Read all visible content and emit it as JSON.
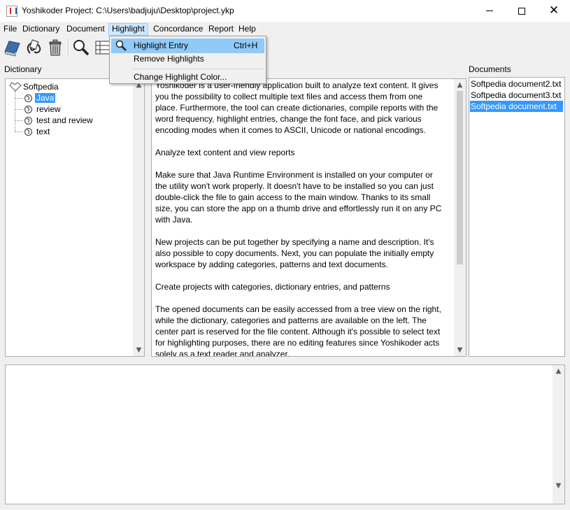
{
  "window": {
    "title": "Yoshikoder Project: C:\\Users\\badjuju\\Desktop\\project.ykp",
    "minimize_glyph": "",
    "maximize_glyph": "",
    "close_glyph": "✕"
  },
  "menubar": {
    "items": [
      "File",
      "Dictionary",
      "Document",
      "Highlight",
      "Concordance",
      "Report",
      "Help"
    ],
    "open_menu": "Highlight"
  },
  "highlight_menu": {
    "items": [
      {
        "label": "Highlight Entry",
        "shortcut": "Ctrl+H",
        "icon": "magnifier-icon",
        "highlighted": true
      },
      {
        "label": "Remove Highlights",
        "shortcut": ""
      },
      {
        "label": "Change Highlight Color...",
        "shortcut": ""
      }
    ]
  },
  "toolbar": {
    "buttons": [
      "open-dictionary-icon",
      "add-documents-icon",
      "trash-icon",
      "search-icon",
      "grid-icon"
    ]
  },
  "dictionary": {
    "label": "Dictionary",
    "root": "Softpedia",
    "entries": [
      "Java",
      "review",
      "test and review",
      "text"
    ],
    "selected": "Java"
  },
  "documents": {
    "label": "Documents",
    "items": [
      "Softpedia document2.txt",
      "Softpedia document3.txt",
      "Softpedia document.txt"
    ],
    "selected": "Softpedia document.txt"
  },
  "content": {
    "lines": [
      "Yoshikoder is a user-friendly application built to analyze text content. It gives",
      "you the possibility to collect multiple text files and access them from one",
      "place. Furthermore, the tool can create dictionaries, compile reports with the",
      "word frequency, highlight entries, change the font face, and pick various",
      "encoding modes when it comes to ASCII, Unicode or national encodings.",
      "",
      "Analyze text content and view reports",
      "",
      "Make sure that Java Runtime Environment is installed on your computer or",
      "the utility won't work properly. It doesn't have to be installed so you can just",
      "double-click the file to gain access to the main window. Thanks to its small",
      "size, you can store the app on a thumb drive and effortlessly run it on any PC",
      "with Java.",
      "",
      "New projects can be put together by specifying a name and description. It's",
      "also possible to copy documents. Next, you can populate the initially empty",
      "workspace by adding categories, patterns and text documents.",
      "",
      "Create projects with categories, dictionary entries, and patterns",
      "",
      "The opened documents can be easily accessed from a tree view on the right,",
      "while the dictionary, categories and patterns are available on the left. The",
      "center part is reserved for the file content. Although it's possible to select text",
      "for highlighting purposes, there are no editing features since Yoshikoder acts",
      "solely as a text reader and analyzer."
    ]
  },
  "scroll_arrows": {
    "up": "▲",
    "down": "▼"
  }
}
